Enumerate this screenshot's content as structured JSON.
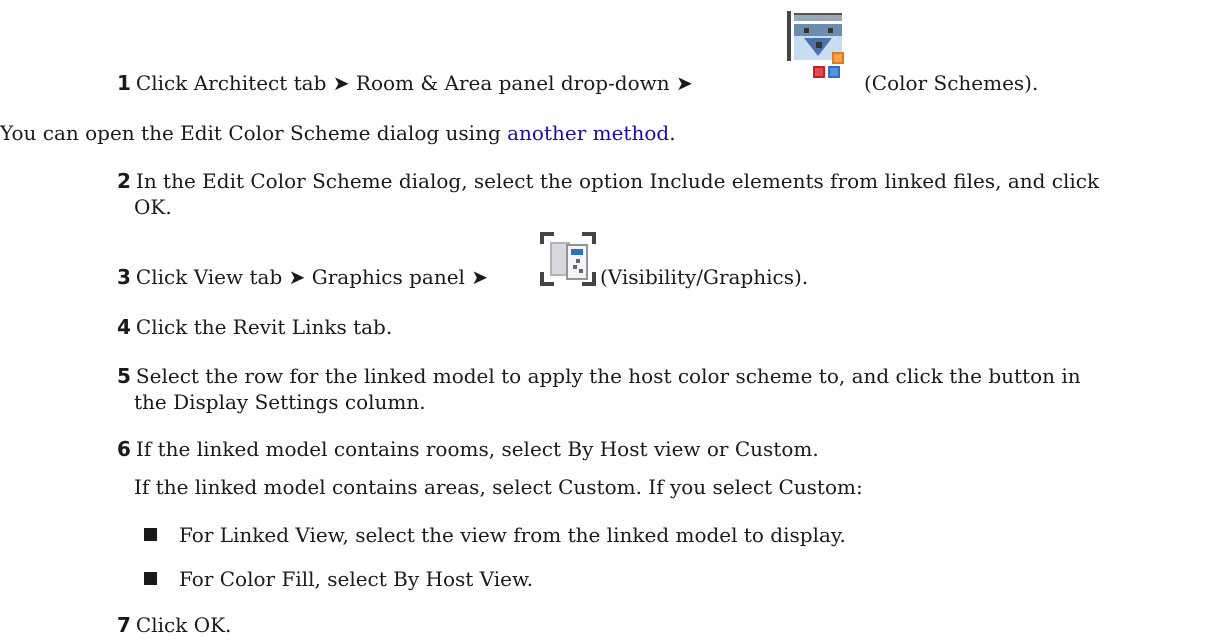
{
  "steps": [
    {
      "num": "1",
      "pre": "Click Architect tab ➤ Room & Area panel drop-down ➤",
      "post": "(Color Schemes).",
      "icon": "color-schemes-icon"
    },
    {
      "num": "2",
      "text_line1": "In the Edit Color Scheme dialog, select the option Include elements from linked files, and click",
      "text_line2": "OK."
    },
    {
      "num": "3",
      "pre": "Click View tab ➤ Graphics panel ➤",
      "post": "(Visibility/Graphics).",
      "icon": "visibility-graphics-icon"
    },
    {
      "num": "4",
      "text": "Click the Revit Links tab."
    },
    {
      "num": "5",
      "text_line1": "Select the row for the linked model to apply the host color scheme to, and click the button in",
      "text_line2": "the Display Settings column."
    },
    {
      "num": "6",
      "text": "If the linked model contains rooms, select By Host view or Custom.",
      "sub": "If the linked model contains areas, select Custom. If you select Custom:"
    },
    {
      "num": "7",
      "text": "Click OK."
    }
  ],
  "note": {
    "pre": "You can open the Edit Color Scheme dialog using ",
    "link": "another method",
    "post": "."
  },
  "bullets": [
    "For Linked View, select the view from the linked model to display.",
    "For Color Fill, select By Host View."
  ]
}
